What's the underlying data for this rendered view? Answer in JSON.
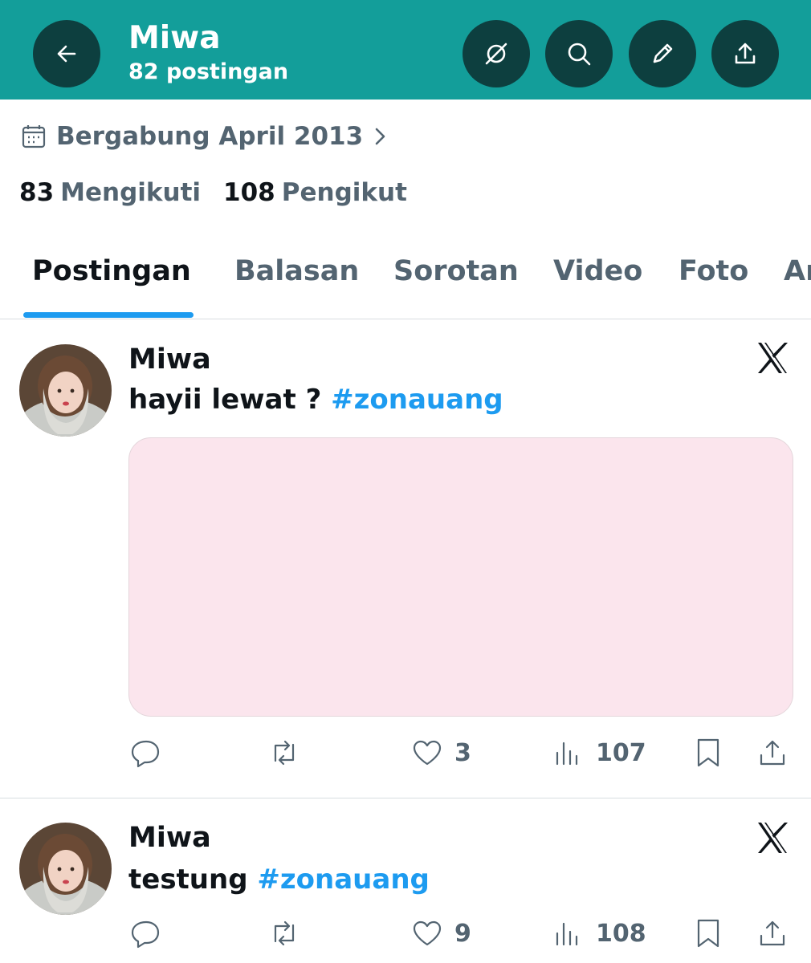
{
  "header": {
    "name": "Miwa",
    "post_count": "82 postingan",
    "accent_color": "#139e9a",
    "icons": [
      "back-arrow-icon",
      "grok-icon",
      "search-icon",
      "edit-pencil-icon",
      "share-upload-icon"
    ]
  },
  "profile": {
    "joined": "Bergabung April 2013",
    "following_count": "83",
    "following_label": "Mengikuti",
    "followers_count": "108",
    "followers_label": "Pengikut"
  },
  "tabs": [
    {
      "label": "Postingan",
      "active": true
    },
    {
      "label": "Balasan",
      "active": false
    },
    {
      "label": "Sorotan",
      "active": false
    },
    {
      "label": "Video",
      "active": false
    },
    {
      "label": "Foto",
      "active": false
    },
    {
      "label": "Ar",
      "active": false
    }
  ],
  "posts": [
    {
      "author": "Miwa",
      "text": "hayii lewat ? ",
      "hashtag": "#zonauang",
      "likes": "3",
      "views": "107"
    },
    {
      "author": "Miwa",
      "text": "testung ",
      "hashtag": "#zonauang",
      "likes": "9",
      "views": "108"
    }
  ]
}
